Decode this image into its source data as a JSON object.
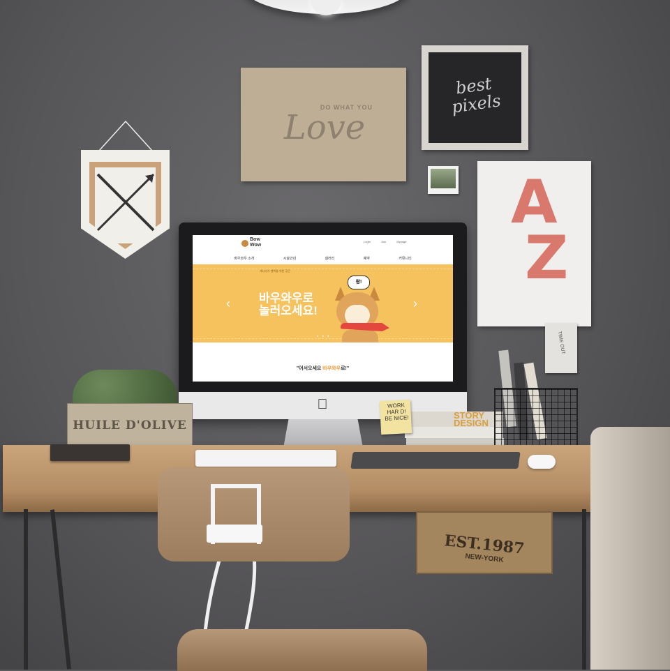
{
  "wall_decor": {
    "love_board": {
      "small_text": "DO WHAT YOU",
      "big_text": "Love"
    },
    "chalkboard": {
      "line1": "best",
      "line2": "pixels"
    },
    "poster": {
      "letter1": "A",
      "letter2": "Z"
    },
    "tag": {
      "text": "TIME OUT"
    }
  },
  "screen": {
    "logo": {
      "line1": "Bow",
      "line2": "Wow"
    },
    "utility_links": [
      "Login",
      "Join",
      "Mypage"
    ],
    "nav": [
      "바우와우 소개",
      "시설안내",
      "갤러리",
      "예약",
      "커뮤니티"
    ],
    "hero": {
      "small_text": "개나리가 행복을 위한 공간",
      "title_line1": "바우와우로",
      "title_line2": "놀러오세요!",
      "speech_bubble": "왕!",
      "prev_arrow": "‹",
      "next_arrow": "›",
      "pagination": "● ● ●"
    },
    "welcome": {
      "prefix": "\"어서오세요 ",
      "highlight": "바우와우",
      "suffix": "로!\""
    }
  },
  "desk": {
    "sticky_note": {
      "line1": "WORK",
      "line2": "HAR D!",
      "line3": "BE NICE!"
    },
    "book_title": {
      "line1": "STORY",
      "line2": "DESIGN"
    },
    "olive_box": {
      "text": "HUILE D'OLIVE"
    },
    "crate": {
      "line1": "EST.1987",
      "line2": "NEW-YORK"
    }
  },
  "colors": {
    "hero_bg": "#f6c25d",
    "accent": "#ef9a34",
    "poster_letters": "#d9786c"
  },
  "icons": [
    "apple-logo-icon",
    "chevron-left-icon",
    "chevron-right-icon",
    "dog-mascot-icon"
  ]
}
